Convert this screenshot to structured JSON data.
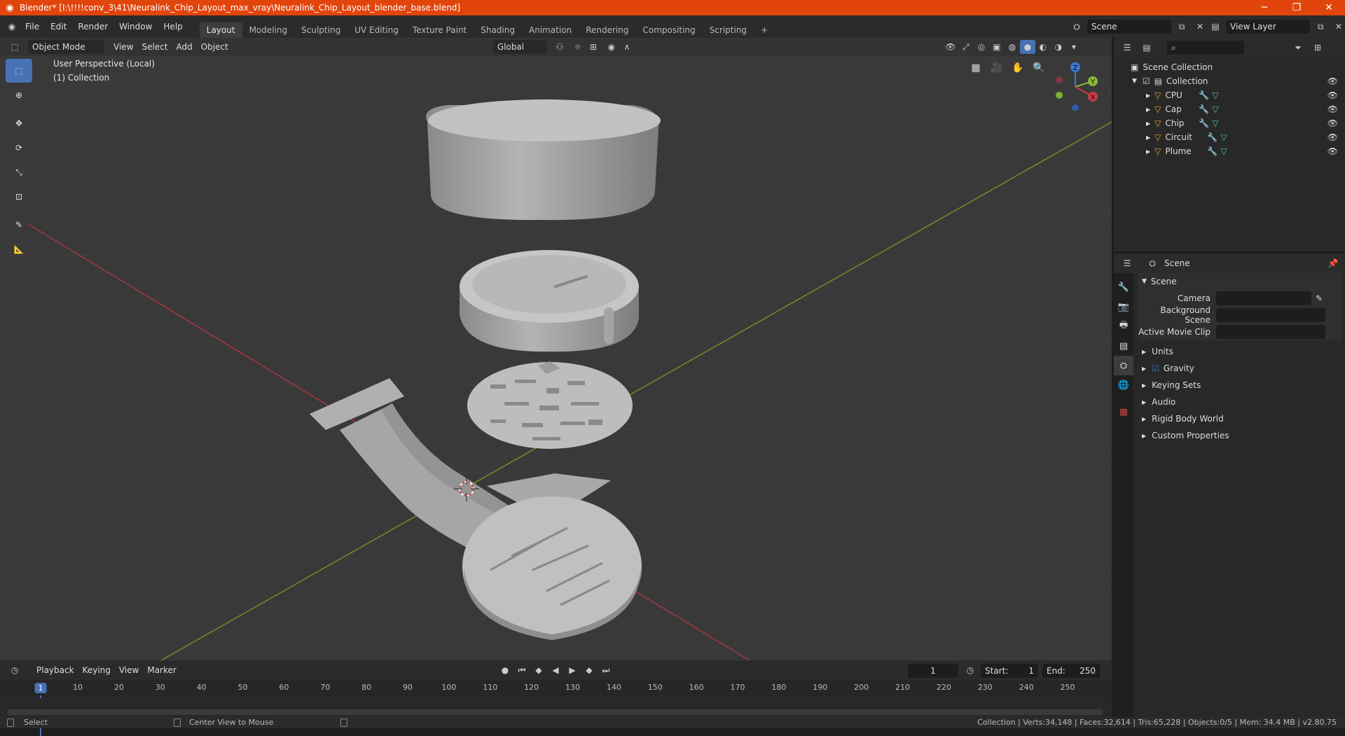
{
  "titlebar": {
    "title": "Blender* [I:\\!!!!conv_3\\41\\Neuralink_Chip_Layout_max_vray\\Neuralink_Chip_Layout_blender_base.blend]",
    "minimize": "─",
    "maximize": "❐",
    "close": "✕"
  },
  "menu": [
    "File",
    "Edit",
    "Render",
    "Window",
    "Help"
  ],
  "workspaces": [
    "Layout",
    "Modeling",
    "Sculpting",
    "UV Editing",
    "Texture Paint",
    "Shading",
    "Animation",
    "Rendering",
    "Compositing",
    "Scripting"
  ],
  "scene_selector": {
    "value": "Scene"
  },
  "viewlayer_selector": {
    "value": "View Layer"
  },
  "viewport_header": {
    "mode": "Object Mode",
    "menus": [
      "View",
      "Select",
      "Add",
      "Object"
    ],
    "transform_orientation": "Global"
  },
  "viewport_overlay": {
    "line1": "User Perspective (Local)",
    "line2": "(1) Collection"
  },
  "gizmo_axes": {
    "x": "X",
    "y": "Y",
    "z": "Z"
  },
  "outliner": {
    "root": "Scene Collection",
    "collection": "Collection",
    "objects": [
      "CPU",
      "Cap",
      "Chip",
      "Circuit",
      "Plume"
    ]
  },
  "properties": {
    "header": "Scene",
    "panel": "Scene",
    "fields": [
      {
        "label": "Camera",
        "value": ""
      },
      {
        "label": "Background Scene",
        "value": ""
      },
      {
        "label": "Active Movie Clip",
        "value": ""
      }
    ],
    "sections": [
      "Units",
      "Gravity",
      "Keying Sets",
      "Audio",
      "Rigid Body World",
      "Custom Properties"
    ]
  },
  "timeline": {
    "menus": [
      "Playback",
      "Keying",
      "View",
      "Marker"
    ],
    "current_frame": "1",
    "start_label": "Start:",
    "start": "1",
    "end_label": "End:",
    "end": "250",
    "ruler_frames": [
      "1",
      "10",
      "20",
      "30",
      "40",
      "50",
      "60",
      "70",
      "80",
      "90",
      "100",
      "110",
      "120",
      "130",
      "140",
      "150",
      "160",
      "170",
      "180",
      "190",
      "200",
      "210",
      "220",
      "230",
      "240",
      "250"
    ]
  },
  "statusbar": {
    "left_action": "Select",
    "middle_action": "Center View to Mouse",
    "stats": "Collection | Verts:34,148 | Faces:32,614 | Tris:65,228 | Objects:0/5 | Mem: 34.4 MB | v2.80.75"
  },
  "colors": {
    "titlebar": "#e2450c",
    "accent": "#4772b3",
    "x_axis": "#c83c46",
    "y_axis": "#8bb833",
    "z_axis": "#3d78d6",
    "object_icon": "#f0a030",
    "mesh_icon": "#4fc0b0"
  }
}
